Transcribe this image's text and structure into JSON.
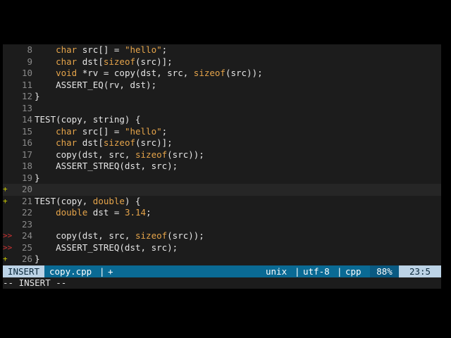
{
  "lines": [
    {
      "gutter": "",
      "num": "8",
      "segs": [
        {
          "t": "    ",
          "c": ""
        },
        {
          "t": "char",
          "c": "kw"
        },
        {
          "t": " src[] = ",
          "c": ""
        },
        {
          "t": "\"hello\"",
          "c": "str"
        },
        {
          "t": ";",
          "c": ""
        }
      ]
    },
    {
      "gutter": "",
      "num": "9",
      "segs": [
        {
          "t": "    ",
          "c": ""
        },
        {
          "t": "char",
          "c": "kw"
        },
        {
          "t": " dst[",
          "c": ""
        },
        {
          "t": "sizeof",
          "c": "kw"
        },
        {
          "t": "(src)];",
          "c": ""
        }
      ]
    },
    {
      "gutter": "",
      "num": "10",
      "segs": [
        {
          "t": "    ",
          "c": ""
        },
        {
          "t": "void",
          "c": "kw"
        },
        {
          "t": " *rv = copy(dst, src, ",
          "c": ""
        },
        {
          "t": "sizeof",
          "c": "kw"
        },
        {
          "t": "(src));",
          "c": ""
        }
      ]
    },
    {
      "gutter": "",
      "num": "11",
      "segs": [
        {
          "t": "    ASSERT_EQ(rv, dst);",
          "c": ""
        }
      ]
    },
    {
      "gutter": "",
      "num": "12",
      "segs": [
        {
          "t": "}",
          "c": ""
        }
      ]
    },
    {
      "gutter": "",
      "num": "13",
      "segs": [
        {
          "t": "",
          "c": ""
        }
      ]
    },
    {
      "gutter": "",
      "num": "14",
      "segs": [
        {
          "t": "TEST(copy, string) {",
          "c": ""
        }
      ]
    },
    {
      "gutter": "",
      "num": "15",
      "segs": [
        {
          "t": "    ",
          "c": ""
        },
        {
          "t": "char",
          "c": "kw"
        },
        {
          "t": " src[] = ",
          "c": ""
        },
        {
          "t": "\"hello\"",
          "c": "str"
        },
        {
          "t": ";",
          "c": ""
        }
      ]
    },
    {
      "gutter": "",
      "num": "16",
      "segs": [
        {
          "t": "    ",
          "c": ""
        },
        {
          "t": "char",
          "c": "kw"
        },
        {
          "t": " dst[",
          "c": ""
        },
        {
          "t": "sizeof",
          "c": "kw"
        },
        {
          "t": "(src)];",
          "c": ""
        }
      ]
    },
    {
      "gutter": "",
      "num": "17",
      "segs": [
        {
          "t": "    copy(dst, src, ",
          "c": ""
        },
        {
          "t": "sizeof",
          "c": "kw"
        },
        {
          "t": "(src));",
          "c": ""
        }
      ]
    },
    {
      "gutter": "",
      "num": "18",
      "segs": [
        {
          "t": "    ASSERT_STREQ(dst, src);",
          "c": ""
        }
      ]
    },
    {
      "gutter": "",
      "num": "19",
      "segs": [
        {
          "t": "}",
          "c": ""
        }
      ]
    },
    {
      "gutter": "+",
      "num": "20",
      "segs": [
        {
          "t": "",
          "c": ""
        }
      ],
      "cursorline": true
    },
    {
      "gutter": "+",
      "num": "21",
      "segs": [
        {
          "t": "TEST(copy, ",
          "c": ""
        },
        {
          "t": "double",
          "c": "kw"
        },
        {
          "t": ") {",
          "c": ""
        }
      ]
    },
    {
      "gutter": "",
      "num": "22",
      "segs": [
        {
          "t": "    ",
          "c": ""
        },
        {
          "t": "double",
          "c": "kw"
        },
        {
          "t": " dst = ",
          "c": ""
        },
        {
          "t": "3.14",
          "c": "num"
        },
        {
          "t": ";",
          "c": ""
        }
      ]
    },
    {
      "gutter": "",
      "num": "23",
      "segs": [
        {
          "t": "",
          "c": ""
        }
      ]
    },
    {
      "gutter": ">>",
      "num": "24",
      "segs": [
        {
          "t": "    copy(dst, src, ",
          "c": ""
        },
        {
          "t": "sizeof",
          "c": "kw"
        },
        {
          "t": "(src));",
          "c": ""
        }
      ]
    },
    {
      "gutter": ">>",
      "num": "25",
      "segs": [
        {
          "t": "    ASSERT_STREQ(dst, src);",
          "c": ""
        }
      ]
    },
    {
      "gutter": "+",
      "num": "26",
      "segs": [
        {
          "t": "}",
          "c": ""
        }
      ]
    }
  ],
  "statusbar": {
    "mode": "INSERT",
    "filename": "copy.cpp",
    "sep": "|",
    "modified": "+",
    "fileformat": "unix",
    "encoding": "utf-8",
    "filetype": "cpp",
    "percent": "88%",
    "position": "23:5"
  },
  "cmdline": "-- INSERT --",
  "colors": {
    "keyword": "#e5a44a",
    "status_bg": "#0a6a94",
    "mode_bg": "#bcd3e6",
    "git_add": "#c8c800",
    "git_mark": "#d23232"
  }
}
